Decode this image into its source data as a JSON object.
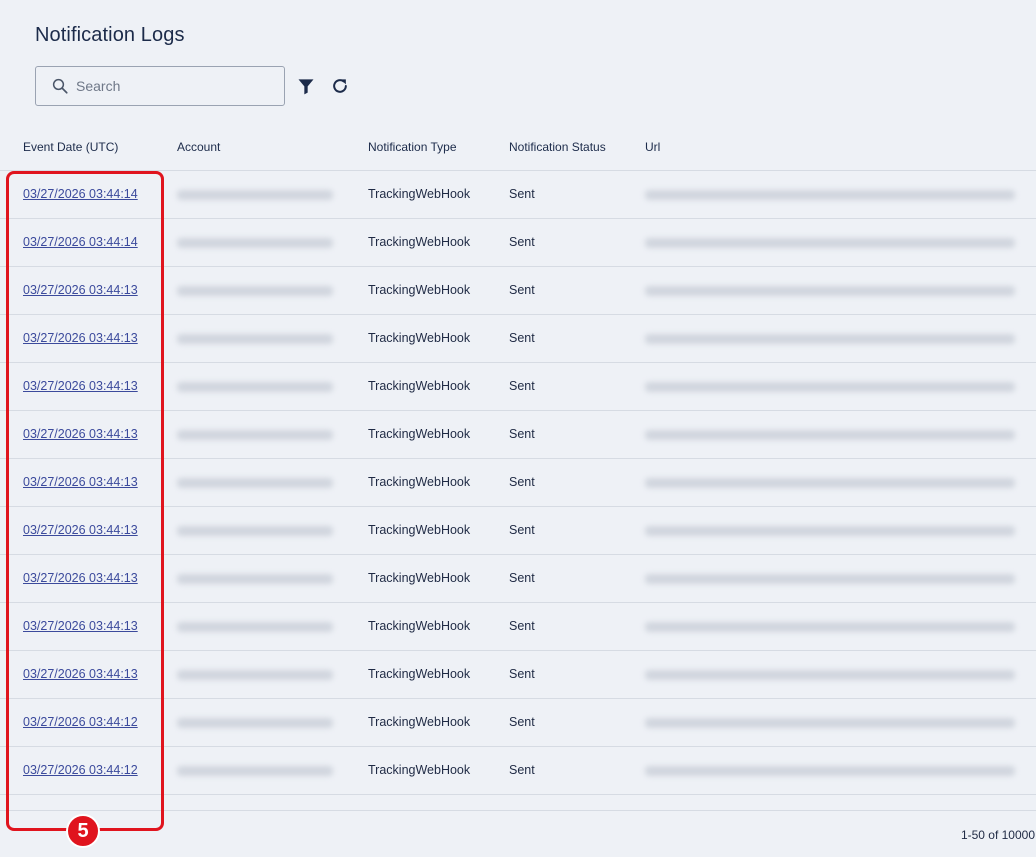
{
  "page": {
    "title": "Notification Logs"
  },
  "toolbar": {
    "search_placeholder": "Search",
    "search_value": "",
    "search_icon": "search-icon",
    "filter_icon": "filter-icon",
    "refresh_icon": "refresh-icon"
  },
  "table": {
    "columns": [
      "Event Date (UTC)",
      "Account",
      "Notification Type",
      "Notification Status",
      "Url"
    ],
    "rows": [
      {
        "date": "03/27/2026 03:44:14",
        "type": "TrackingWebHook",
        "status": "Sent"
      },
      {
        "date": "03/27/2026 03:44:14",
        "type": "TrackingWebHook",
        "status": "Sent"
      },
      {
        "date": "03/27/2026 03:44:13",
        "type": "TrackingWebHook",
        "status": "Sent"
      },
      {
        "date": "03/27/2026 03:44:13",
        "type": "TrackingWebHook",
        "status": "Sent"
      },
      {
        "date": "03/27/2026 03:44:13",
        "type": "TrackingWebHook",
        "status": "Sent"
      },
      {
        "date": "03/27/2026 03:44:13",
        "type": "TrackingWebHook",
        "status": "Sent"
      },
      {
        "date": "03/27/2026 03:44:13",
        "type": "TrackingWebHook",
        "status": "Sent"
      },
      {
        "date": "03/27/2026 03:44:13",
        "type": "TrackingWebHook",
        "status": "Sent"
      },
      {
        "date": "03/27/2026 03:44:13",
        "type": "TrackingWebHook",
        "status": "Sent"
      },
      {
        "date": "03/27/2026 03:44:13",
        "type": "TrackingWebHook",
        "status": "Sent"
      },
      {
        "date": "03/27/2026 03:44:13",
        "type": "TrackingWebHook",
        "status": "Sent"
      },
      {
        "date": "03/27/2026 03:44:12",
        "type": "TrackingWebHook",
        "status": "Sent"
      },
      {
        "date": "03/27/2026 03:44:12",
        "type": "TrackingWebHook",
        "status": "Sent"
      }
    ]
  },
  "pagination": {
    "label": "1-50 of 10000"
  },
  "annotation": {
    "callout_number": "5",
    "color": "#e0141e"
  },
  "colors": {
    "link": "#3b4a9c",
    "background": "#eef1f6",
    "text": "#1f2a44"
  }
}
